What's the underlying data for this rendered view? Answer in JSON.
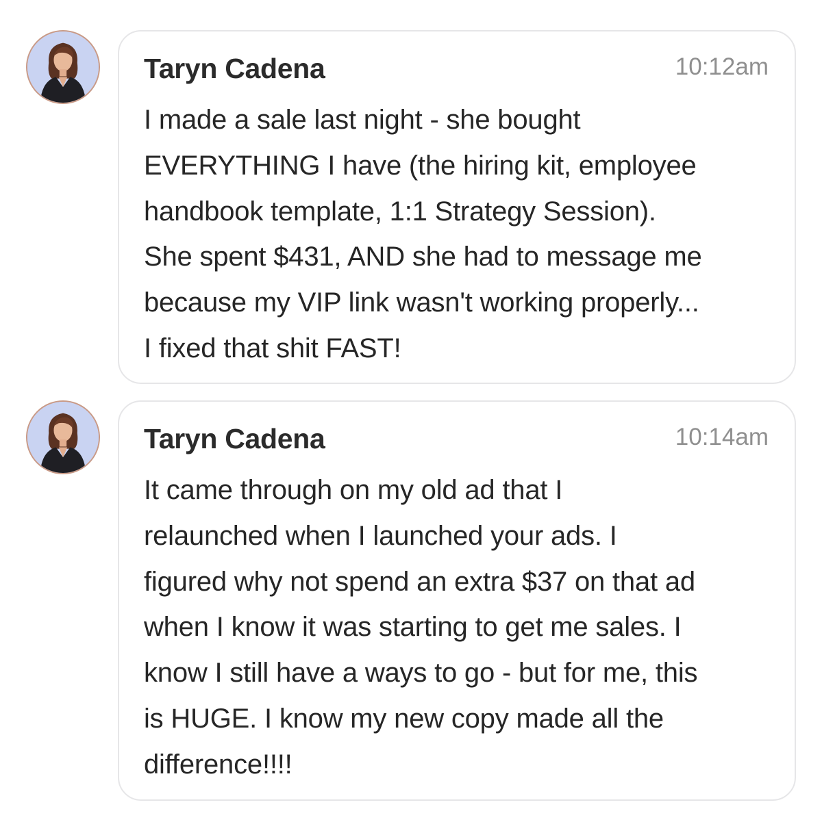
{
  "messages": [
    {
      "sender": "Taryn Cadena",
      "time": "10:12am",
      "lines": [
        "I made a sale last night - she bought",
        "EVERYTHING I have (the hiring kit, employee",
        "handbook template, 1:1 Strategy Session).",
        "She spent $431, AND she had to message me",
        "because my VIP link wasn't working properly...",
        "I fixed that shit FAST!"
      ]
    },
    {
      "sender": "Taryn Cadena",
      "time": "10:14am",
      "lines": [
        "It came through on my old ad that I",
        "relaunched when I launched your ads. I",
        "figured why not spend an extra $37 on that ad",
        "when I know it was starting to get me sales. I",
        "know I still have a ways to go - but for me, this",
        "is HUGE. I know my new copy made all the",
        "difference!!!!"
      ]
    }
  ],
  "colors": {
    "bubble_border": "#e6e6e8",
    "avatar_ring": "#c99a86",
    "avatar_bg": "#c9d3f2",
    "sender": "#2b2b2b",
    "time": "#8f8f8f",
    "body_text": "#262626"
  }
}
